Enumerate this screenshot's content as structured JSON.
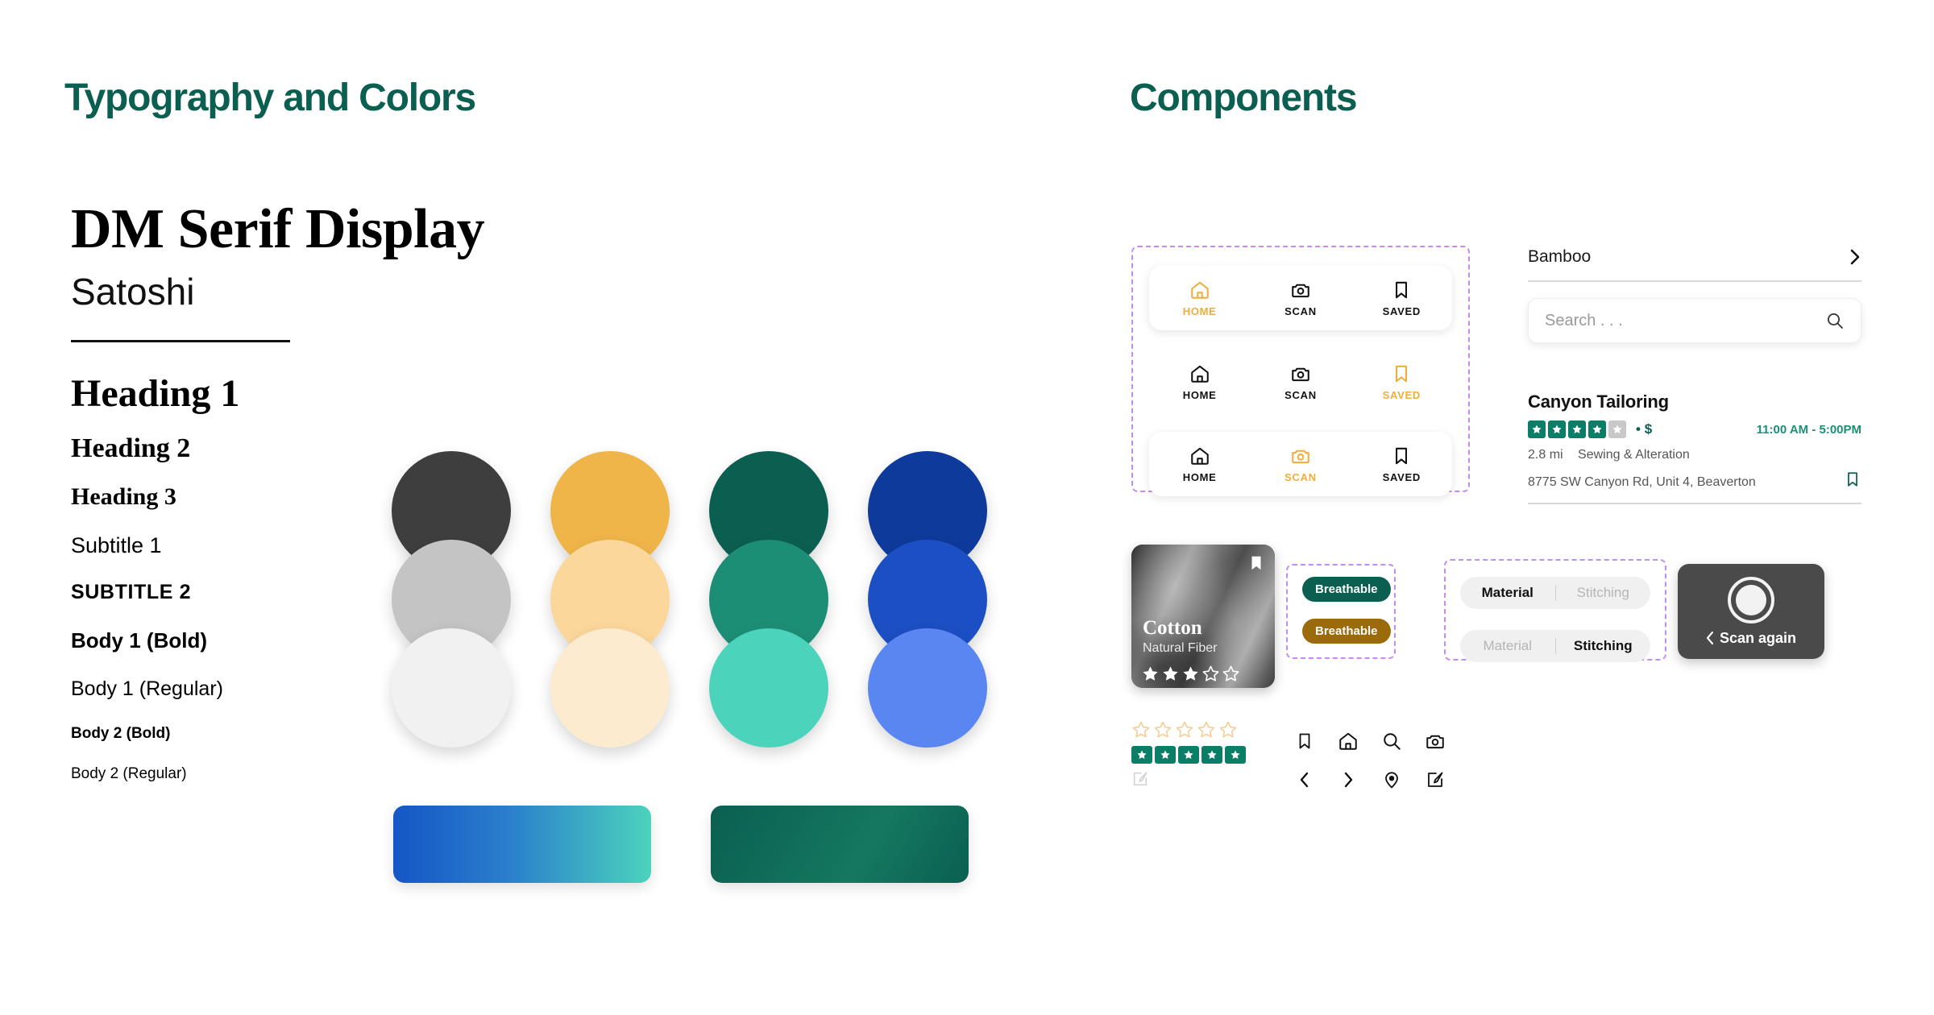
{
  "sections": {
    "typography_title": "Typography and Colors",
    "components_title": "Components"
  },
  "typography": {
    "serif_family": "DM Serif Display",
    "sans_family": "Satoshi",
    "scale": [
      {
        "label": "Heading 1"
      },
      {
        "label": "Heading 2"
      },
      {
        "label": "Heading 3"
      },
      {
        "label": "Subtitle 1"
      },
      {
        "label": "SUBTITLE 2"
      },
      {
        "label": "Body 1 (Bold)"
      },
      {
        "label": "Body 1 (Regular)"
      },
      {
        "label": "Body 2 (Bold)"
      },
      {
        "label": "Body 2 (Regular)"
      }
    ]
  },
  "palette": {
    "columns": [
      {
        "name": "neutral",
        "swatches": [
          "#3E3E3E",
          "#C4C4C4",
          "#F1F1F1"
        ]
      },
      {
        "name": "amber",
        "swatches": [
          "#F0B549",
          "#FBD79B",
          "#FCEBCF"
        ]
      },
      {
        "name": "teal",
        "swatches": [
          "#0B5F51",
          "#1D8E76",
          "#4CD3BC"
        ]
      },
      {
        "name": "blue",
        "swatches": [
          "#0E3A9B",
          "#1D4FC4",
          "#5A86F2"
        ]
      }
    ],
    "gradients": [
      {
        "name": "blue-to-mint",
        "from": "#1556C6",
        "to": "#4CD3BC"
      },
      {
        "name": "deep-teal",
        "from": "#0B5F51",
        "to": "#14785F"
      }
    ],
    "accent_amber": "#EFAE3C",
    "accent_teal": "#0B5F51",
    "chip_brown": "#9A6A0B"
  },
  "components": {
    "navbars": [
      {
        "active": "HOME",
        "items": [
          {
            "label": "HOME",
            "icon": "home-icon"
          },
          {
            "label": "SCAN",
            "icon": "camera-icon"
          },
          {
            "label": "SAVED",
            "icon": "bookmark-icon"
          }
        ]
      },
      {
        "active": "SAVED",
        "items": [
          {
            "label": "HOME",
            "icon": "home-icon"
          },
          {
            "label": "SCAN",
            "icon": "camera-icon"
          },
          {
            "label": "SAVED",
            "icon": "bookmark-icon"
          }
        ]
      },
      {
        "active": "SCAN",
        "items": [
          {
            "label": "HOME",
            "icon": "home-icon"
          },
          {
            "label": "SCAN",
            "icon": "camera-icon"
          },
          {
            "label": "SAVED",
            "icon": "bookmark-icon"
          }
        ]
      }
    ],
    "list_row": {
      "label": "Bamboo",
      "chevron": "chevron-right-icon"
    },
    "search": {
      "placeholder": "Search . . .",
      "value": "",
      "icon": "search-icon"
    },
    "listing": {
      "name": "Canyon Tailoring",
      "rating": 4,
      "rating_max": 5,
      "price": "$",
      "separator": "•",
      "hours": "11:00 AM - 5:00PM",
      "distance": "2.8 mi",
      "category": "Sewing & Alteration",
      "address": "8775 SW Canyon Rd, Unit 4, Beaverton",
      "bookmark_icon": "bookmark-icon"
    },
    "product_card": {
      "title": "Cotton",
      "subtitle": "Natural Fiber",
      "rating": 3,
      "rating_max": 5,
      "bookmark_icon": "bookmark-icon"
    },
    "chips": [
      {
        "label": "Breathable",
        "color": "#0B5F51"
      },
      {
        "label": "Breathable",
        "color": "#9A6A0B"
      }
    ],
    "segmented": [
      {
        "options": [
          "Material",
          "Stitching"
        ],
        "selected": "Material"
      },
      {
        "options": [
          "Material",
          "Stitching"
        ],
        "selected": "Stitching"
      }
    ],
    "scan_button": {
      "label": "Scan again",
      "back_icon": "chevron-left-icon",
      "shutter_icon": "shutter-icon"
    },
    "ratings": {
      "empty": {
        "count": 5,
        "filled": 0,
        "color": "#F3CE96"
      },
      "filled": {
        "count": 5,
        "filled": 5,
        "color": "#0B7E68"
      }
    },
    "icon_grid": [
      "bookmark-icon",
      "home-icon",
      "search-icon",
      "camera-icon",
      "chevron-left-icon",
      "chevron-right-icon",
      "location-pin-icon",
      "edit-icon"
    ]
  }
}
